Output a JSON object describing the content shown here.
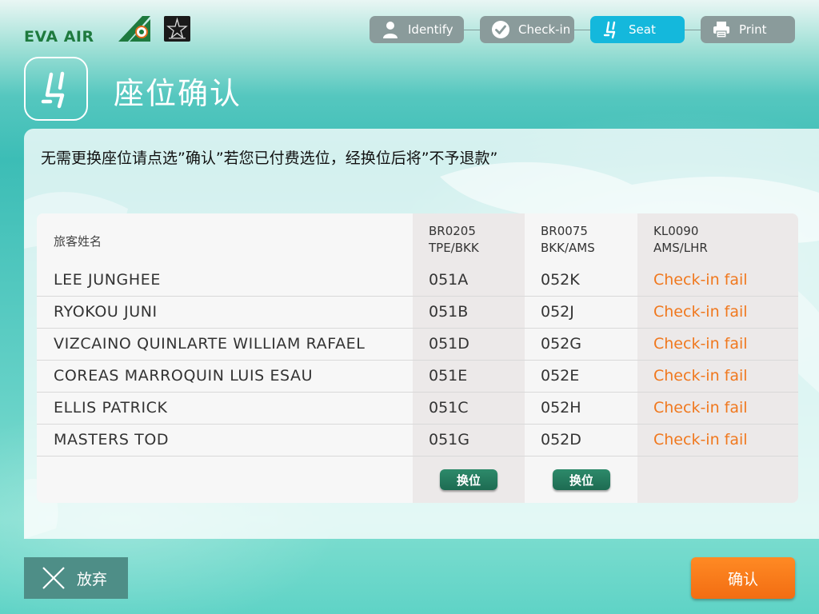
{
  "brand": {
    "logo_text": "EVA AIR",
    "colors": {
      "green": "#1e7a3e",
      "orange": "#f0781e",
      "cyan": "#14b8dc",
      "teal": "#4e8e87"
    }
  },
  "steps": [
    {
      "label": "Identify",
      "icon": "person-icon",
      "active": false
    },
    {
      "label": "Check-in",
      "icon": "checkmark-icon",
      "active": false
    },
    {
      "label": "Seat",
      "icon": "seat-icon",
      "active": true
    },
    {
      "label": "Print",
      "icon": "printer-icon",
      "active": false
    }
  ],
  "page": {
    "title": "座位确认",
    "title_icon": "seat-icon",
    "instruction": "无需更换座位请点选”确认”若您已付费选位，经换位后将”不予退款”"
  },
  "table": {
    "name_header": "旅客姓名",
    "flights": [
      {
        "number": "BR0205",
        "route": "TPE/BKK"
      },
      {
        "number": "BR0075",
        "route": "BKK/AMS"
      },
      {
        "number": "KL0090",
        "route": "AMS/LHR"
      }
    ],
    "rows": [
      {
        "name": "LEE JUNGHEE",
        "seat1": "051A",
        "seat2": "052K",
        "status3": "Check-in fail"
      },
      {
        "name": "RYOKOU JUNI",
        "seat1": "051B",
        "seat2": "052J",
        "status3": "Check-in fail"
      },
      {
        "name": "VIZCAINO QUINLARTE WILLIAM RAFAEL",
        "seat1": "051D",
        "seat2": "052G",
        "status3": "Check-in fail"
      },
      {
        "name": "COREAS MARROQUIN LUIS ESAU",
        "seat1": "051E",
        "seat2": "052E",
        "status3": "Check-in fail"
      },
      {
        "name": "ELLIS PATRICK",
        "seat1": "051C",
        "seat2": "052H",
        "status3": "Check-in fail"
      },
      {
        "name": "MASTERS TOD",
        "seat1": "051G",
        "seat2": "052D",
        "status3": "Check-in fail"
      }
    ],
    "change_seat_label": "换位"
  },
  "footer": {
    "abandon_label": "放弃",
    "abandon_icon": "close-icon",
    "confirm_label": "确认"
  }
}
